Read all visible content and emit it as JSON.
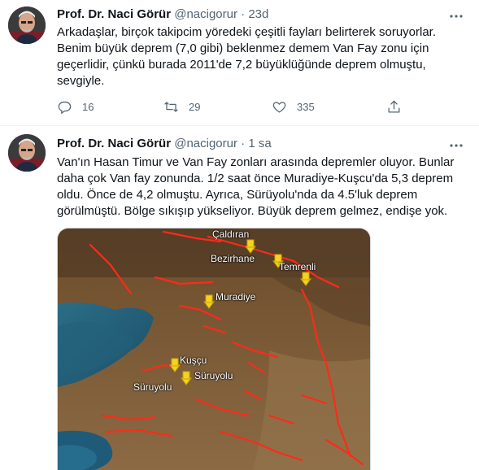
{
  "tweets": [
    {
      "author_name": "Prof. Dr. Naci Görür",
      "handle": "@nacigorur",
      "separator": "·",
      "time": "23d",
      "text": "Arkadaşlar, birçok takipcim yöredeki çeşitli fayları belirterek soruyorlar. Benim büyük deprem (7,0 gibi) beklenmez demem Van Fay zonu için geçerlidir, çünkü burada 2011'de 7,2 büyüklüğünde deprem olmuştu, sevgiyle.",
      "reply_count": "16",
      "retweet_count": "29",
      "like_count": "335"
    },
    {
      "author_name": "Prof. Dr. Naci Görür",
      "handle": "@nacigorur",
      "separator": "·",
      "time": "1 sa",
      "text": "Van'ın Hasan Timur ve Van Fay zonları arasında depremler oluyor. Bunlar daha çok Van fay zonunda. 1/2 saat önce Muradiye-Kuşcu'da 5,3 deprem oldu. Önce de 4,2 olmuştu. Ayrıca, Sürüyolu'nda da 4.5'luk deprem görülmüştü. Bölge sıkışıp yükseliyor. Büyük deprem gelmez, endişe yok.",
      "map_labels": {
        "caldiran": "Çaldıran",
        "bezirhane": "Bezirhane",
        "temrenli": "Temrenli",
        "muradiye": "Muradiye",
        "kuscu": "Kuşçu",
        "suruyolu_village": "Süruyolu",
        "suruyolu": "Süruyolu"
      }
    }
  ],
  "icons": {
    "reply": "reply-icon",
    "retweet": "retweet-icon",
    "like": "heart-icon",
    "share": "share-icon",
    "more": "more-options-icon"
  },
  "colors": {
    "text": "#0f1419",
    "secondary": "#536471",
    "fault_lines": "#ff2a1a",
    "pins": "#f5d21c"
  }
}
